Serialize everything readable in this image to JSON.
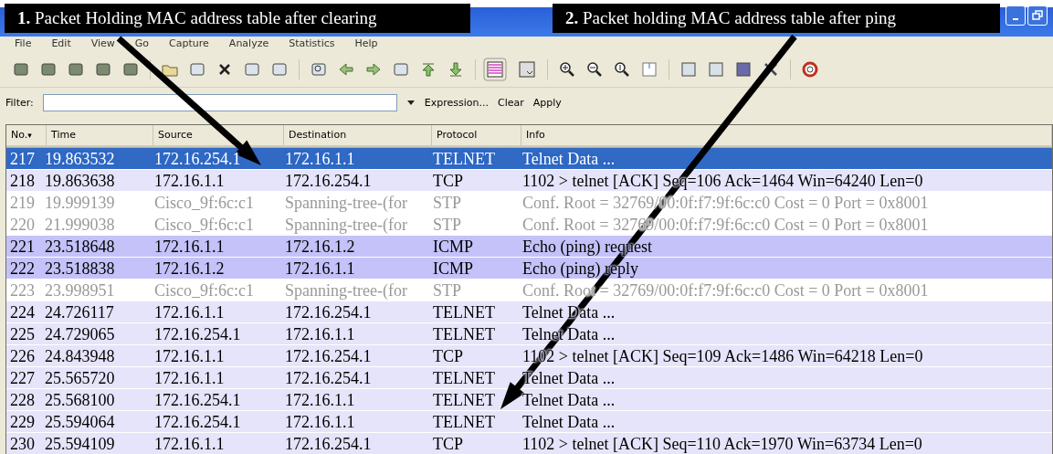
{
  "callouts": [
    {
      "number": "1.",
      "text": "Packet Holding MAC address table after clearing"
    },
    {
      "number": "2.",
      "text": "Packet holding MAC address table after ping"
    }
  ],
  "menu": [
    "File",
    "Edit",
    "View",
    "Go",
    "Capture",
    "Analyze",
    "Statistics",
    "Help"
  ],
  "filter": {
    "label": "Filter:",
    "actions": [
      "Expression...",
      "Clear",
      "Apply"
    ]
  },
  "table": {
    "columns": [
      "No.",
      "Time",
      "Source",
      "Destination",
      "Protocol",
      "Info"
    ],
    "sort_marker": "▾",
    "rows": [
      {
        "no": "217",
        "time": "19.863532",
        "source": "172.16.254.1",
        "destination": "172.16.1.1",
        "protocol": "TELNET",
        "info": "Telnet Data ...",
        "selected": true,
        "color": "#316ac5",
        "dimmed": false
      },
      {
        "no": "218",
        "time": "19.863638",
        "source": "172.16.1.1",
        "destination": "172.16.254.1",
        "protocol": "TCP",
        "info": "1102 > telnet [ACK] Seq=106 Ack=1464 Win=64240 Len=0",
        "selected": false,
        "color": "#e6e4fa",
        "dimmed": false
      },
      {
        "no": "219",
        "time": "19.999139",
        "source": "Cisco_9f:6c:c1",
        "destination": "Spanning-tree-(for",
        "protocol": "STP",
        "info": "Conf. Root = 32769/00:0f:f7:9f:6c:c0  Cost = 0  Port = 0x8001",
        "selected": false,
        "color": "#ffffff",
        "dimmed": true
      },
      {
        "no": "220",
        "time": "21.999038",
        "source": "Cisco_9f:6c:c1",
        "destination": "Spanning-tree-(for",
        "protocol": "STP",
        "info": "Conf. Root = 32769/00:0f:f7:9f:6c:c0  Cost = 0  Port = 0x8001",
        "selected": false,
        "color": "#ffffff",
        "dimmed": true
      },
      {
        "no": "221",
        "time": "23.518648",
        "source": "172.16.1.1",
        "destination": "172.16.1.2",
        "protocol": "ICMP",
        "info": "Echo (ping) request",
        "selected": false,
        "color": "#c4c2f8",
        "dimmed": false
      },
      {
        "no": "222",
        "time": "23.518838",
        "source": "172.16.1.2",
        "destination": "172.16.1.1",
        "protocol": "ICMP",
        "info": "Echo (ping) reply",
        "selected": false,
        "color": "#c4c2f8",
        "dimmed": false
      },
      {
        "no": "223",
        "time": "23.998951",
        "source": "Cisco_9f:6c:c1",
        "destination": "Spanning-tree-(for",
        "protocol": "STP",
        "info": "Conf. Root = 32769/00:0f:f7:9f:6c:c0  Cost = 0  Port = 0x8001",
        "selected": false,
        "color": "#ffffff",
        "dimmed": true
      },
      {
        "no": "224",
        "time": "24.726117",
        "source": "172.16.1.1",
        "destination": "172.16.254.1",
        "protocol": "TELNET",
        "info": "Telnet Data ...",
        "selected": false,
        "color": "#e6e4fa",
        "dimmed": false
      },
      {
        "no": "225",
        "time": "24.729065",
        "source": "172.16.254.1",
        "destination": "172.16.1.1",
        "protocol": "TELNET",
        "info": "Telnet Data ...",
        "selected": false,
        "color": "#e6e4fa",
        "dimmed": false
      },
      {
        "no": "226",
        "time": "24.843948",
        "source": "172.16.1.1",
        "destination": "172.16.254.1",
        "protocol": "TCP",
        "info": "1102 > telnet [ACK] Seq=109 Ack=1486 Win=64218 Len=0",
        "selected": false,
        "color": "#e6e4fa",
        "dimmed": false
      },
      {
        "no": "227",
        "time": "25.565720",
        "source": "172.16.1.1",
        "destination": "172.16.254.1",
        "protocol": "TELNET",
        "info": "Telnet Data ...",
        "selected": false,
        "color": "#e6e4fa",
        "dimmed": false
      },
      {
        "no": "228",
        "time": "25.568100",
        "source": "172.16.254.1",
        "destination": "172.16.1.1",
        "protocol": "TELNET",
        "info": "Telnet Data ...",
        "selected": false,
        "color": "#e6e4fa",
        "dimmed": false
      },
      {
        "no": "229",
        "time": "25.594064",
        "source": "172.16.254.1",
        "destination": "172.16.1.1",
        "protocol": "TELNET",
        "info": "Telnet Data ...",
        "selected": false,
        "color": "#e6e4fa",
        "dimmed": false
      },
      {
        "no": "230",
        "time": "25.594109",
        "source": "172.16.1.1",
        "destination": "172.16.254.1",
        "protocol": "TCP",
        "info": "1102 > telnet [ACK] Seq=110 Ack=1970 Win=63734 Len=0",
        "selected": false,
        "color": "#e6e4fa",
        "dimmed": false
      }
    ]
  }
}
